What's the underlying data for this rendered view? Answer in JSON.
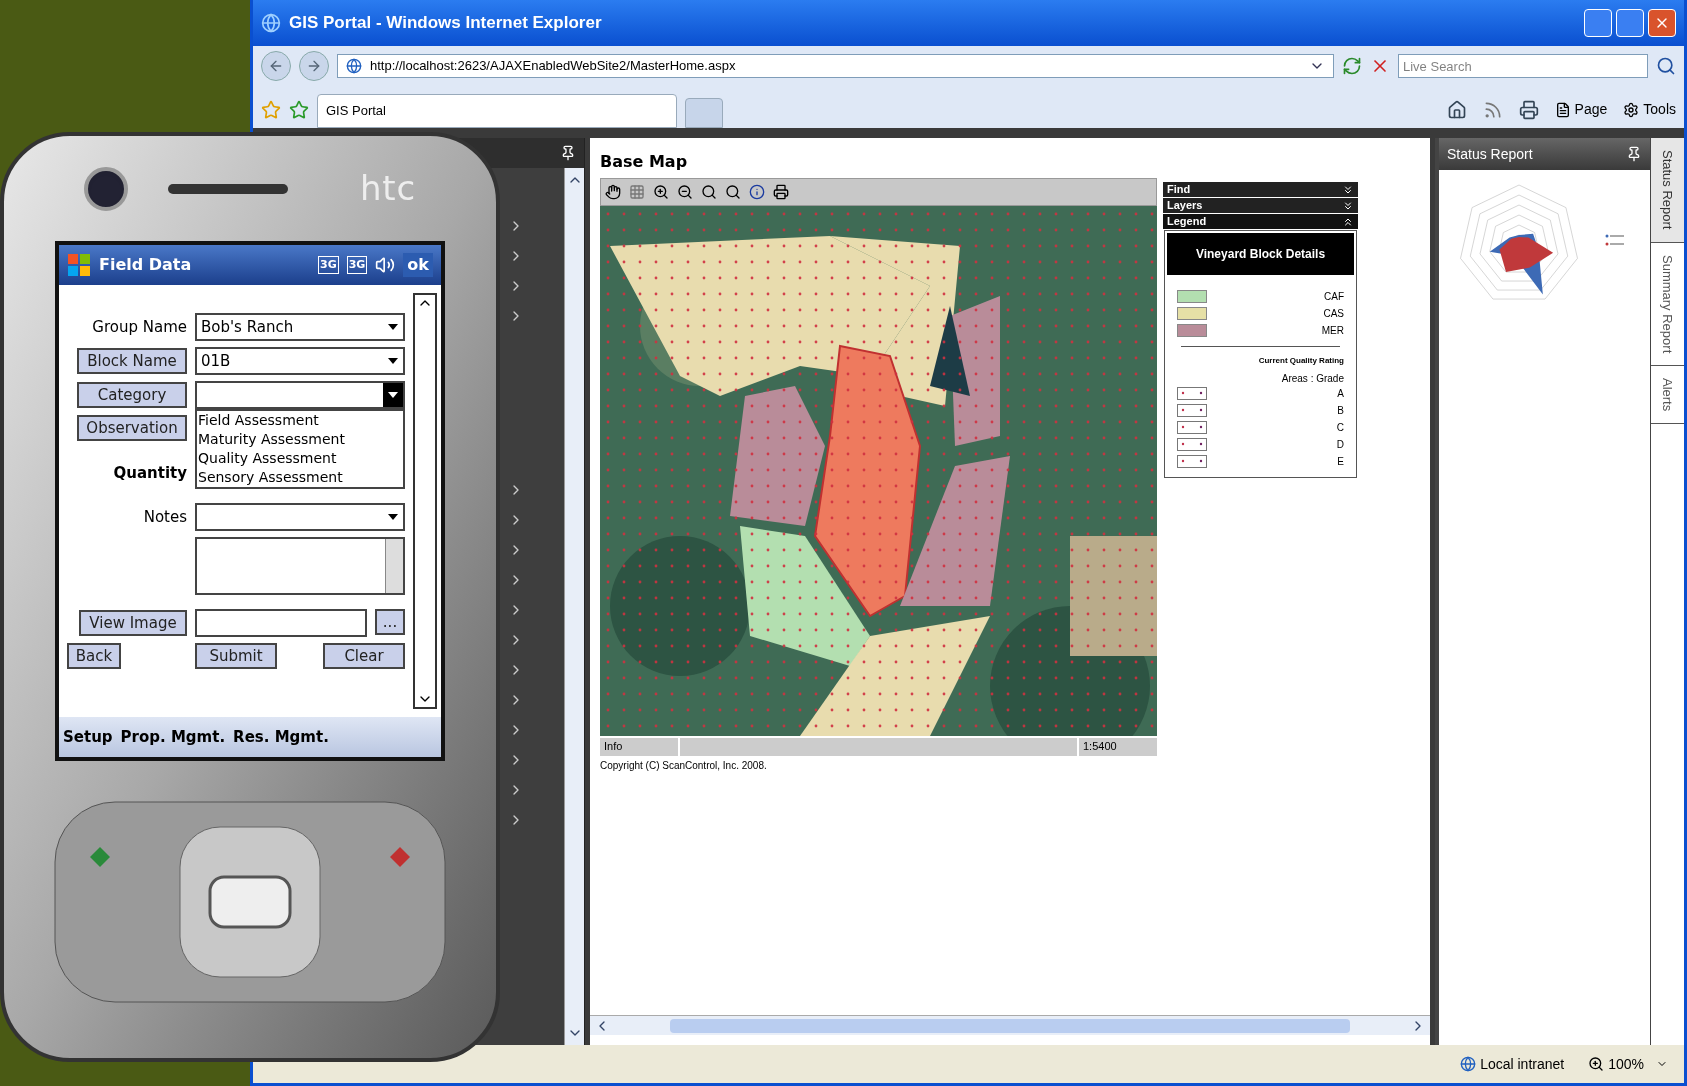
{
  "browser": {
    "title": "GIS Portal - Windows Internet Explorer",
    "address": "http://localhost:2623/AJAXEnabledWebSite2/MasterHome.aspx",
    "search": {
      "placeholder": "Live Search"
    },
    "tabs": [
      {
        "label": "GIS Portal",
        "selected": true
      }
    ],
    "commands": [
      "Page",
      "Tools"
    ]
  },
  "map_panel": {
    "title": "Base Map",
    "info": "Info",
    "scale": "1:5400",
    "copyright": "Copyright (C) ScanControl, Inc. 2008."
  },
  "side_sections": [
    {
      "label": "Find",
      "expanded": false
    },
    {
      "label": "Layers",
      "expanded": false
    },
    {
      "label": "Legend",
      "expanded": true
    }
  ],
  "legend": {
    "title": "Vineyard Block Details",
    "varieties": [
      {
        "label": "CAF",
        "color": "#b3dfb0"
      },
      {
        "label": "CAS",
        "color": "#e6e0a6"
      },
      {
        "label": "MER",
        "color": "#b98c99"
      }
    ],
    "rating_title": "Current Quality Rating",
    "rating_subtitle": "Areas : Grade",
    "grades": [
      "A",
      "B",
      "C",
      "D",
      "E"
    ]
  },
  "status_panel": {
    "title": "Status Report"
  },
  "side_tabs": [
    {
      "label": "Status Report",
      "selected": true
    },
    {
      "label": "Summary Report",
      "selected": false
    },
    {
      "label": "Alerts",
      "selected": false
    }
  ],
  "status_bar": {
    "zone": "Local intranet",
    "zoom": "100%"
  },
  "phone": {
    "brand": "htc",
    "app_title": "Field Data",
    "indicators": [
      "3G",
      "3G"
    ],
    "ok": "ok",
    "labels": [
      {
        "text": "Group Name",
        "kind": "text"
      },
      {
        "text": "Block Name",
        "kind": "button"
      },
      {
        "text": "Category",
        "kind": "button"
      },
      {
        "text": "Observation",
        "kind": "button"
      },
      {
        "text": "Quantity",
        "kind": "bold"
      },
      {
        "text": "Notes",
        "kind": "text"
      }
    ],
    "group_name": "Bob's Ranch",
    "block_name": "01B",
    "category_options": [
      "Field Assessment",
      "Maturity Assessment",
      "Quality Assessment",
      "Sensory Assessment"
    ],
    "view_image": "View Image",
    "browse": "...",
    "actions": [
      "Back",
      "Submit",
      "Clear"
    ],
    "menu": [
      "Setup",
      "Prop. Mgmt.",
      "Res. Mgmt."
    ]
  }
}
